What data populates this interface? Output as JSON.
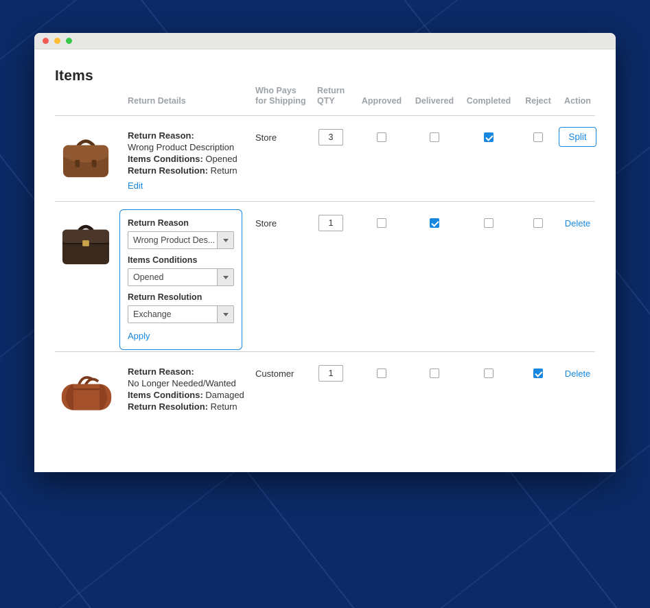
{
  "page": {
    "title": "Items"
  },
  "window": {
    "controls": {
      "close": "close",
      "minimize": "minimize",
      "zoom": "zoom"
    }
  },
  "table": {
    "headers": {
      "details": "Return Details",
      "shipping": "Who Pays\nfor Shipping",
      "qty": "Return\nQTY",
      "approved": "Approved",
      "delivered": "Delivered",
      "completed": "Completed",
      "reject": "Reject",
      "action": "Action"
    },
    "rows": [
      {
        "product_icon": "brown-satchel-bag",
        "details": {
          "reason_label": "Return Reason:",
          "reason": "Wrong Product Description",
          "condition_label": "Items Conditions:",
          "condition": "Opened",
          "resolution_label": "Return Resolution:",
          "resolution": "Return",
          "edit_link": "Edit"
        },
        "shipping": "Store",
        "qty": "3",
        "approved": false,
        "delivered": false,
        "completed": true,
        "reject": false,
        "action": "Split"
      },
      {
        "product_icon": "dark-brown-briefcase",
        "edit_form": {
          "reason_label": "Return Reason",
          "reason_value": "Wrong Product Des...",
          "condition_label": "Items Conditions",
          "condition_value": "Opened",
          "resolution_label": "Return Resolution",
          "resolution_value": "Exchange",
          "apply_link": "Apply"
        },
        "shipping": "Store",
        "qty": "1",
        "approved": false,
        "delivered": true,
        "completed": false,
        "reject": false,
        "action": "Delete"
      },
      {
        "product_icon": "red-brown-duffel-bag",
        "details": {
          "reason_label": "Return Reason:",
          "reason": "No Longer Needed/Wanted",
          "condition_label": "Items Conditions:",
          "condition": "Damaged",
          "resolution_label": "Return Resolution:",
          "resolution": "Return"
        },
        "shipping": "Customer",
        "qty": "1",
        "approved": false,
        "delivered": false,
        "completed": false,
        "reject": true,
        "action": "Delete"
      }
    ]
  },
  "colors": {
    "accent_blue": "#1787e0",
    "link_blue": "#1787e0",
    "background_navy": "#0b2a66",
    "checkbox_checked": "#1787e0"
  }
}
